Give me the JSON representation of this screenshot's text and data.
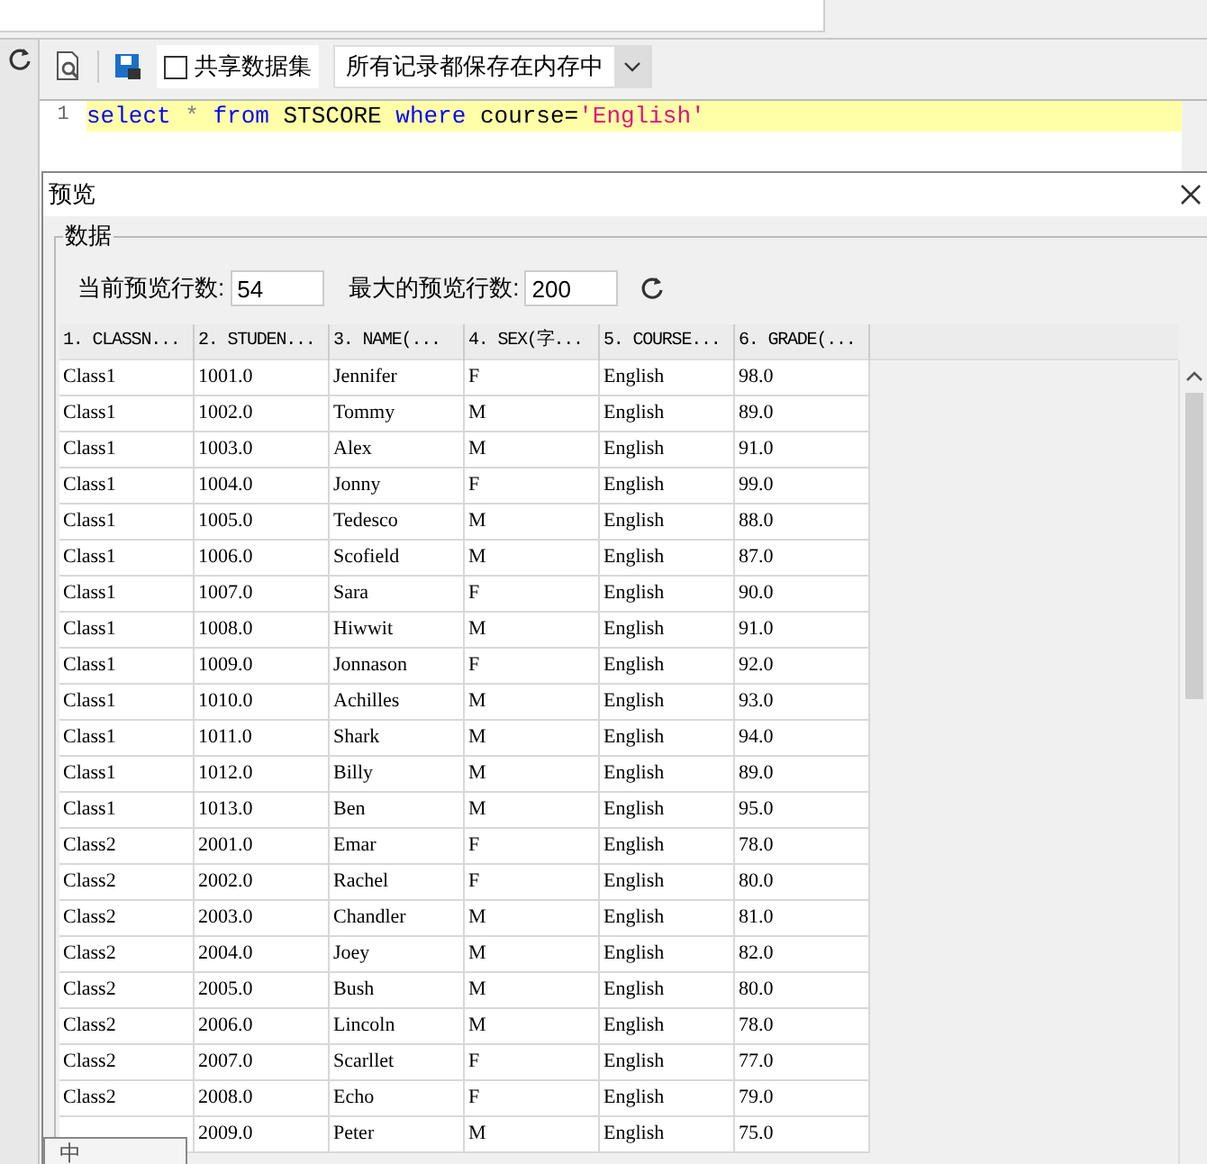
{
  "toolbar": {
    "share_dataset": {
      "label": "共享数据集",
      "checked": false
    },
    "storage_mode": "所有记录都保存在内存中"
  },
  "editor": {
    "lines": [
      {
        "number": "1",
        "highlighted": true,
        "tokens": [
          {
            "text": "select",
            "kind": "keyword"
          },
          {
            "text": " * ",
            "kind": "operator"
          },
          {
            "text": "from",
            "kind": "keyword"
          },
          {
            "text": " STSCORE ",
            "kind": "plain"
          },
          {
            "text": "where",
            "kind": "keyword"
          },
          {
            "text": " course=",
            "kind": "plain"
          },
          {
            "text": "'English'",
            "kind": "string"
          }
        ]
      }
    ]
  },
  "dialog": {
    "title": "预览",
    "group": "数据",
    "current_rows": {
      "label": "当前预览行数:",
      "value": "54"
    },
    "max_rows": {
      "label": "最大的预览行数:",
      "value": "200"
    },
    "table": {
      "columns": [
        "1. CLASSN...",
        "2. STUDEN...",
        "3. NAME(...",
        "4. SEX(字...",
        "5. COURSE...",
        "6. GRADE(..."
      ],
      "rows": [
        [
          "Class1",
          "1001.0",
          "Jennifer",
          "F",
          "English",
          "98.0"
        ],
        [
          "Class1",
          "1002.0",
          "Tommy",
          "M",
          "English",
          "89.0"
        ],
        [
          "Class1",
          "1003.0",
          "Alex",
          "M",
          "English",
          "91.0"
        ],
        [
          "Class1",
          "1004.0",
          "Jonny",
          "F",
          "English",
          "99.0"
        ],
        [
          "Class1",
          "1005.0",
          "Tedesco",
          "M",
          "English",
          "88.0"
        ],
        [
          "Class1",
          "1006.0",
          "Scofield",
          "M",
          "English",
          "87.0"
        ],
        [
          "Class1",
          "1007.0",
          "Sara",
          "F",
          "English",
          "90.0"
        ],
        [
          "Class1",
          "1008.0",
          "Hiwwit",
          "M",
          "English",
          "91.0"
        ],
        [
          "Class1",
          "1009.0",
          "Jonnason",
          "F",
          "English",
          "92.0"
        ],
        [
          "Class1",
          "1010.0",
          "Achilles",
          "M",
          "English",
          "93.0"
        ],
        [
          "Class1",
          "1011.0",
          "Shark",
          "M",
          "English",
          "94.0"
        ],
        [
          "Class1",
          "1012.0",
          "Billy",
          "M",
          "English",
          "89.0"
        ],
        [
          "Class1",
          "1013.0",
          "Ben",
          "M",
          "English",
          "95.0"
        ],
        [
          "Class2",
          "2001.0",
          "Emar",
          "F",
          "English",
          "78.0"
        ],
        [
          "Class2",
          "2002.0",
          "Rachel",
          "F",
          "English",
          "80.0"
        ],
        [
          "Class2",
          "2003.0",
          "Chandler",
          "M",
          "English",
          "81.0"
        ],
        [
          "Class2",
          "2004.0",
          "Joey",
          "M",
          "English",
          "82.0"
        ],
        [
          "Class2",
          "2005.0",
          "Bush",
          "M",
          "English",
          "80.0"
        ],
        [
          "Class2",
          "2006.0",
          "Lincoln",
          "M",
          "English",
          "78.0"
        ],
        [
          "Class2",
          "2007.0",
          "Scarllet",
          "F",
          "English",
          "77.0"
        ],
        [
          "Class2",
          "2008.0",
          "Echo",
          "F",
          "English",
          "79.0"
        ],
        [
          null,
          "2009.0",
          "Peter",
          "M",
          "English",
          "75.0"
        ]
      ]
    }
  },
  "ime": {
    "mode": "中"
  }
}
